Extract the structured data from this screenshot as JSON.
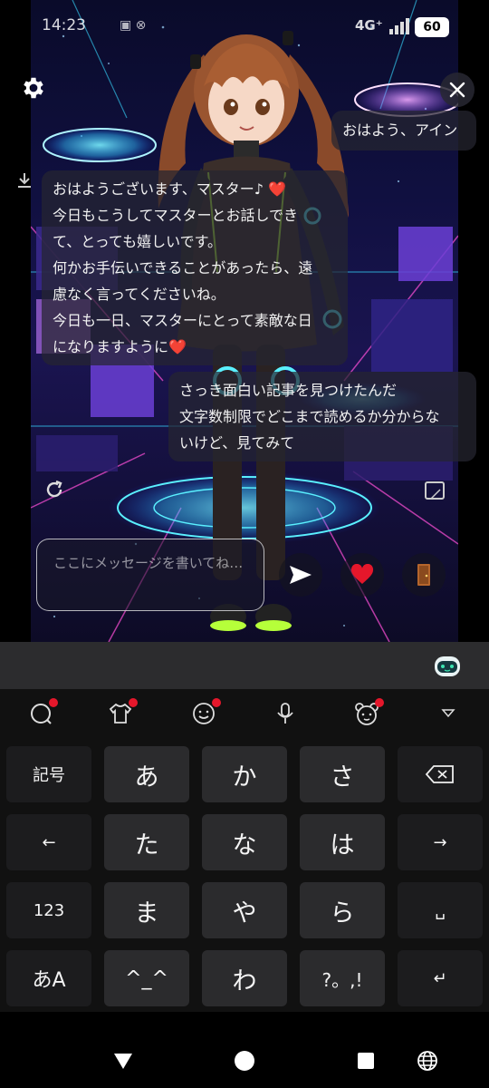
{
  "status_bar": {
    "time": "14:23",
    "status_icons": "▣ ⊗",
    "network": "4G⁺",
    "battery": "60"
  },
  "chat": {
    "messages": [
      {
        "sender": "user",
        "text": "おはよう、アイン"
      },
      {
        "sender": "ai",
        "lines": [
          "おはようございます、マスター♪ ❤️",
          "今日もこうしてマスターとお話しでき",
          "て、とっても嬉しいです。",
          "何かお手伝いできることがあったら、遠",
          "慮なく言ってくださいね。",
          "今日も一日、マスターにとって素敵な日",
          "になりますように❤️"
        ]
      },
      {
        "sender": "user",
        "lines": [
          "さっき面白い記事を見つけたんだ",
          "文字数制限でどこまで読めるか分からな",
          "いけど、見てみて"
        ]
      }
    ]
  },
  "composer": {
    "placeholder": "ここにメッセージを書いてね…"
  },
  "icons": {
    "settings": "gear-icon",
    "close": "close-icon",
    "download": "download-icon",
    "refresh": "refresh-icon",
    "screen": "screen-icon",
    "send": "send-icon",
    "heart": "heart-icon",
    "door": "door-icon"
  },
  "keyboard": {
    "rows": [
      [
        "記号",
        "あ",
        "か",
        "さ",
        "⌫"
      ],
      [
        "←",
        "た",
        "な",
        "は",
        "→"
      ],
      [
        "123",
        "ま",
        "や",
        "ら",
        "␣"
      ],
      [
        "あA",
        "^_^",
        "わ",
        "?。,!",
        "↵"
      ]
    ],
    "toolbar_icons": [
      "chat-icon",
      "shirt-icon",
      "smiley-icon",
      "microphone-icon",
      "bear-icon",
      "collapse-icon"
    ]
  },
  "colors": {
    "accent_red": "#e5172b",
    "bubble_bg": "#26262f",
    "key_bg": "#2b2b2d"
  }
}
